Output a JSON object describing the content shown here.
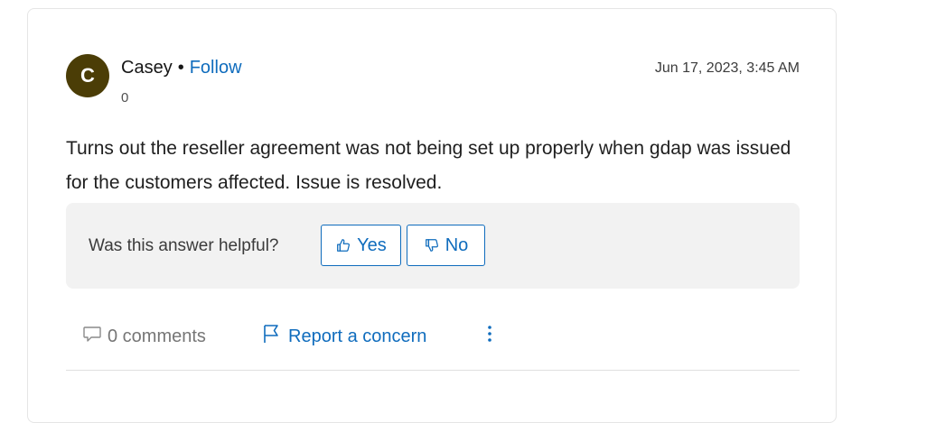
{
  "author": {
    "avatar_initial": "C",
    "avatar_color": "#4b3d06",
    "name": "Casey",
    "separator": "•",
    "follow_label": "Follow",
    "reputation": "0"
  },
  "timestamp": "Jun 17, 2023, 3:45 AM",
  "answer": {
    "body": "Turns out the reseller agreement was not being set up properly when gdap was issued for the customers affected. Issue is resolved."
  },
  "feedback": {
    "question": "Was this answer helpful?",
    "yes_label": "Yes",
    "no_label": "No",
    "yes_icon": "thumbs-up-icon",
    "no_icon": "thumbs-down-icon"
  },
  "actions": {
    "comments_label": "0 comments",
    "comments_icon": "comment-icon",
    "report_label": "Report a concern",
    "report_icon": "flag-icon",
    "more_icon": "more-vertical-icon"
  },
  "colors": {
    "accent": "#0f6cbd",
    "muted": "#767676",
    "panel": "#f2f2f2"
  }
}
